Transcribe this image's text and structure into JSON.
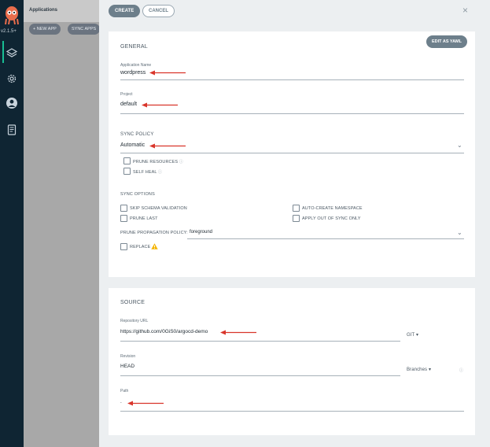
{
  "app": {
    "version": "v2.1.5+"
  },
  "nav": {
    "icons": [
      "argo-logo-icon",
      "layers-icon",
      "gear-icon",
      "user-icon",
      "docs-icon"
    ]
  },
  "apps_page": {
    "title": "Applications",
    "new_app_label": "+ NEW APP",
    "sync_apps_label": "SYNC APPS"
  },
  "panel": {
    "create_label": "CREATE",
    "cancel_label": "CANCEL",
    "close_glyph": "×",
    "edit_yaml_label": "EDIT AS YAML"
  },
  "general": {
    "title": "GENERAL",
    "app_name_label": "Application Name",
    "app_name_value": "wordpress",
    "project_label": "Project",
    "project_value": "default",
    "sync_policy_title": "SYNC POLICY",
    "sync_policy_value": "Automatic",
    "prune_resources_label": "PRUNE RESOURCES",
    "self_heal_label": "SELF HEAL",
    "sync_options_title": "SYNC OPTIONS",
    "skip_schema_label": "SKIP SCHEMA VALIDATION",
    "auto_create_ns_label": "AUTO-CREATE NAMESPACE",
    "prune_last_label": "PRUNE LAST",
    "apply_out_of_sync_label": "APPLY OUT OF SYNC ONLY",
    "prune_propagation_label": "PRUNE PROPAGATION POLICY:",
    "prune_propagation_value": "foreground",
    "replace_label": "REPLACE"
  },
  "source": {
    "title": "SOURCE",
    "repo_url_label": "Repository URL",
    "repo_url_value": "https://github.com/0GiS0/argocd-demo",
    "repo_type_value": "GIT",
    "revision_label": "Revision",
    "revision_value": "HEAD",
    "revision_type_value": "Branches",
    "path_label": "Path",
    "path_value": "."
  },
  "colors": {
    "nav_bg": "#0f2533",
    "panel_bg": "#eceff1",
    "button_gray": "#6d7f8b",
    "annotation_red": "#d9352b",
    "accent_teal": "#18be94"
  }
}
